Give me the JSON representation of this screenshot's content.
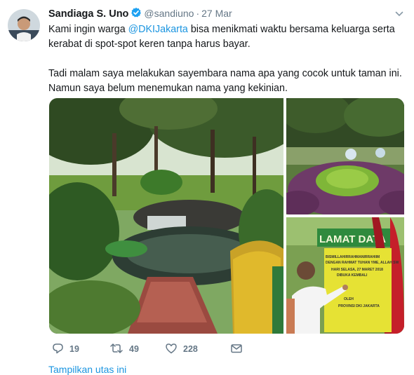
{
  "tweet": {
    "author_name": "Sandiaga S. Uno",
    "handle": "@sandiuno",
    "separator": "·",
    "date": "27 Mar",
    "text_line1_pre": "Kami ingin warga ",
    "mention": "@DKIJakarta",
    "text_line1_post": " bisa menikmati waktu bersama keluarga serta kerabat di spot-spot keren tanpa harus bayar.",
    "text_para2": "Tadi malam saya melakukan sayembara nama apa yang cocok untuk taman ini. Namun saya belum menemukan nama yang kekinian."
  },
  "media": {
    "sign_banner": "LAMAT DATA",
    "sign_lines": [
      "BISMILLAHIRRAHMANIRRAHIIM",
      "DENGAN RAHMAT TUHAN YME, ALLAH SW",
      "HARI SELASA, 27 MARET 2018",
      "DIBUKA KEMBALI",
      "OLEH",
      "PROVINSI DKI JAKARTA"
    ]
  },
  "actions": {
    "reply_count": "19",
    "retweet_count": "49",
    "like_count": "228"
  },
  "thread_link": "Tampilkan utas ini",
  "colors": {
    "accent": "#1b95e0",
    "muted": "#657786",
    "verified": "#1da1f2"
  }
}
